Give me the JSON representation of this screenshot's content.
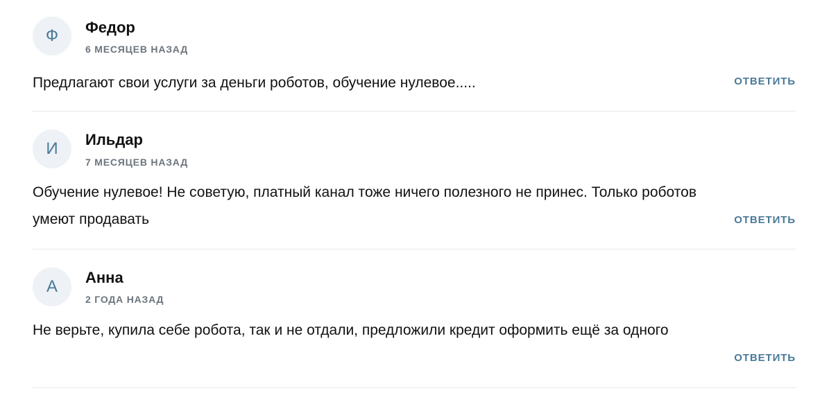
{
  "comments": [
    {
      "initial": "Ф",
      "author": "Федор",
      "date": "6 МЕСЯЦЕВ НАЗАД",
      "text": "Предлагают свои услуги за деньги роботов, обучение нулевое.....",
      "reply_label": "ОТВЕТИТЬ"
    },
    {
      "initial": "И",
      "author": "Ильдар",
      "date": "7 МЕСЯЦЕВ НАЗАД",
      "text": "Обучение нулевое! Не советую, платный канал тоже ничего полезного не принес. Только роботов умеют продавать",
      "reply_label": "ОТВЕТИТЬ"
    },
    {
      "initial": "А",
      "author": "Анна",
      "date": "2 ГОДА НАЗАД",
      "text": "Не верьте, купила себе робота, так и не отдали, предложили кредит оформить ещё за одного",
      "reply_label": "ОТВЕТИТЬ"
    }
  ],
  "colors": {
    "accent": "#4a7a98",
    "avatar_bg": "#eef1f5",
    "meta": "#6c757d",
    "divider": "#e6e9ee"
  }
}
